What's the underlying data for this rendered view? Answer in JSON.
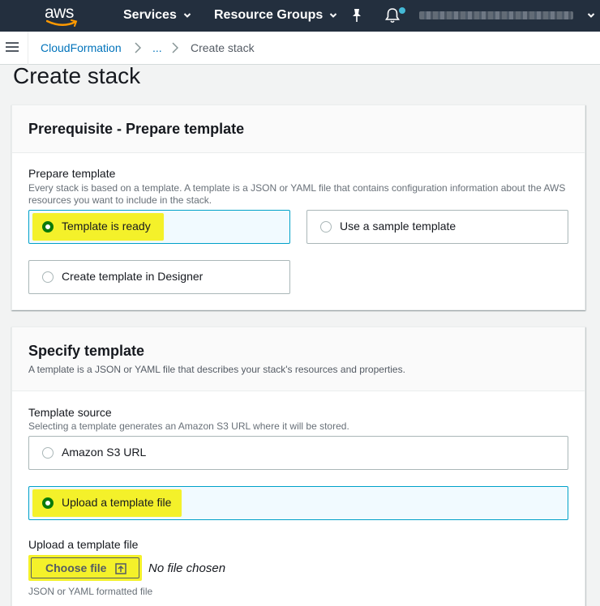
{
  "topnav": {
    "logo_text": "aws",
    "services_label": "Services",
    "resource_groups_label": "Resource Groups",
    "icons": [
      "pin-icon",
      "bell-icon",
      "caret-down-icon"
    ]
  },
  "breadcrumb": {
    "items": [
      "CloudFormation",
      "...",
      "Create stack"
    ]
  },
  "page": {
    "title": "Create stack"
  },
  "prereq": {
    "title": "Prerequisite - Prepare template",
    "field_label": "Prepare template",
    "field_desc": "Every stack is based on a template. A template is a JSON or YAML file that contains configuration information about the AWS resources you want to include in the stack.",
    "options": [
      "Template is ready",
      "Use a sample template",
      "Create template in Designer"
    ],
    "selected": "Template is ready"
  },
  "specify": {
    "title": "Specify template",
    "desc": "A template is a JSON or YAML file that describes your stack's resources and properties.",
    "source_label": "Template source",
    "source_desc": "Selecting a template generates an Amazon S3 URL where it will be stored.",
    "options": [
      "Amazon S3 URL",
      "Upload a template file"
    ],
    "selected": "Upload a template file",
    "upload_label": "Upload a template file",
    "choose_file_label": "Choose file",
    "no_file_text": "No file chosen",
    "format_hint": "JSON or YAML formatted file"
  },
  "colors": {
    "nav_bg": "#232f3e",
    "link": "#0073bb",
    "selected_radio": "#0a7a0a",
    "selected_tile_border": "#00a1c9",
    "highlight": "#f4f12a"
  }
}
